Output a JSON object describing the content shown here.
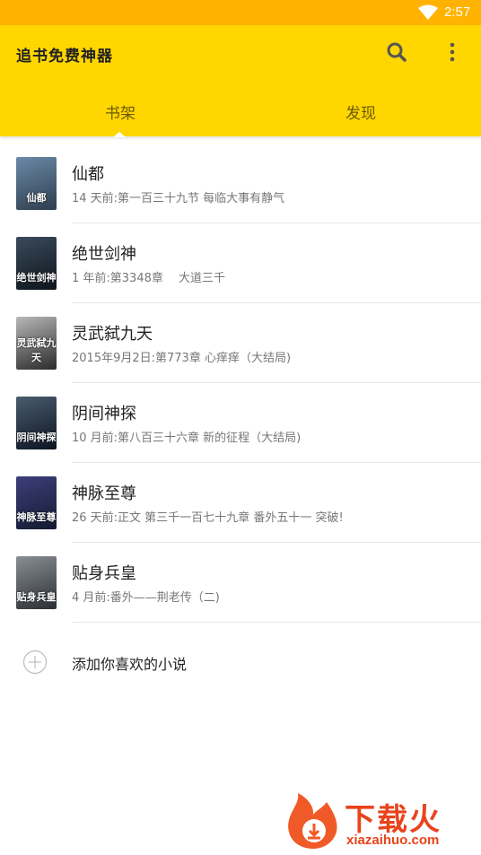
{
  "status_bar": {
    "time": "2:57",
    "wifi_icon": "wifi-icon"
  },
  "app_bar": {
    "title": "追书免费神器",
    "search_icon": "search-icon",
    "more_icon": "more-vertical-icon",
    "colors": {
      "background": "#FFD600",
      "status": "#FFB300"
    }
  },
  "tabs": [
    {
      "label": "书架",
      "selected": true
    },
    {
      "label": "发现",
      "selected": false
    }
  ],
  "books": [
    {
      "title": "仙都",
      "subtitle": "14 天前:第一百三十九节 每临大事有静气",
      "cover_text": "仙都",
      "cover_colors": [
        "#6a8aa8",
        "#2f3d4d"
      ]
    },
    {
      "title": "绝世剑神",
      "subtitle": "1 年前:第3348章　 大道三千",
      "cover_text": "绝世剑神",
      "cover_colors": [
        "#3a4b5c",
        "#0e141b"
      ]
    },
    {
      "title": "灵武弑九天",
      "subtitle": "2015年9月2日:第773章 心痒痒（大结局)",
      "cover_text": "灵武弑九天",
      "cover_colors": [
        "#b8b8b8",
        "#2a2a2a"
      ]
    },
    {
      "title": "阴间神探",
      "subtitle": "10 月前:第八百三十六章 新的征程（大结局)",
      "cover_text": "阴间神探",
      "cover_colors": [
        "#4a5c70",
        "#0c1420"
      ]
    },
    {
      "title": "神脉至尊",
      "subtitle": "26 天前:正文 第三千一百七十九章 番外五十一 突破!",
      "cover_text": "神脉至尊",
      "cover_colors": [
        "#3d3f7a",
        "#141a30"
      ]
    },
    {
      "title": "贴身兵皇",
      "subtitle": "4 月前:番外——荆老传（二)",
      "cover_text": "贴身兵皇",
      "cover_colors": [
        "#8a8f95",
        "#2b2f34"
      ]
    }
  ],
  "add_book": {
    "label": "添加你喜欢的小说",
    "icon": "add-circle-icon"
  },
  "watermark": {
    "brand": "下载火",
    "url": "xiazaihuo.com",
    "logo_icon": "flame-logo-icon"
  }
}
